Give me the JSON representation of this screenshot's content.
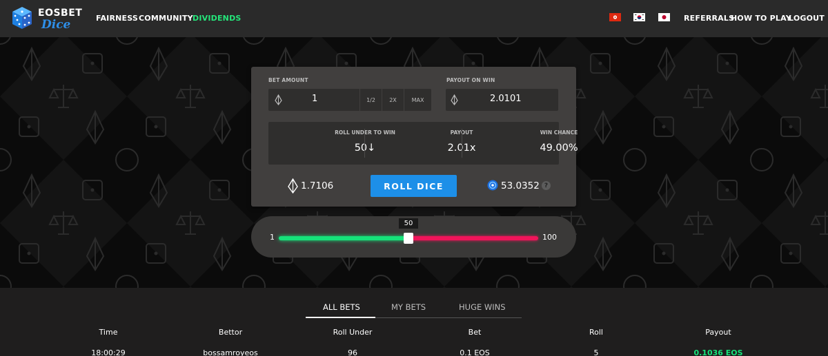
{
  "nav": {
    "logo_top": "EOSBET",
    "logo_bottom": "Dice",
    "links_left": [
      "FAIRNESS",
      "COMMUNITY",
      "DIVIDENDS"
    ],
    "links_right": [
      "REFERRALS",
      "HOW TO PLAY",
      "LOGOUT"
    ],
    "flags": [
      "hong-kong-flag",
      "south-korea-flag",
      "japan-flag"
    ],
    "colors": {
      "bar": "#2a2a2a",
      "highlight": "#24e57a"
    }
  },
  "bet": {
    "amount_label": "BET AMOUNT",
    "amount_value": "1",
    "half_label": "1/2",
    "double_label": "2X",
    "max_label": "MAX",
    "payout_label": "PAYOUT ON WIN",
    "payout_value": "2.0101"
  },
  "stats": {
    "roll_under_label": "ROLL UNDER TO WIN",
    "roll_under_value": "50↓",
    "payout_label": "PAYOUT",
    "payout_value": "2.01x",
    "win_chance_label": "WIN CHANCE",
    "win_chance_value": "49.00%"
  },
  "actions": {
    "roll_button": "ROLL DICE",
    "eos_balance": "1.7106",
    "bet_balance": "53.0352",
    "help": "?",
    "accent": "#1d8fe8"
  },
  "slider": {
    "min": "1",
    "max": "100",
    "value": "50",
    "value_fraction": 0.5,
    "colors": {
      "win": "#16e27a",
      "lose": "#f0155a"
    }
  },
  "bets": {
    "tabs": [
      "ALL BETS",
      "MY BETS",
      "HUGE WINS"
    ],
    "active_tab": "ALL BETS",
    "columns": [
      "Time",
      "Bettor",
      "Roll Under",
      "Bet",
      "Roll",
      "Payout"
    ],
    "rows": [
      [
        "18:00:29",
        "bossamroyeos",
        "96",
        "0.1 EOS",
        "5",
        "0.1036 EOS"
      ]
    ]
  }
}
